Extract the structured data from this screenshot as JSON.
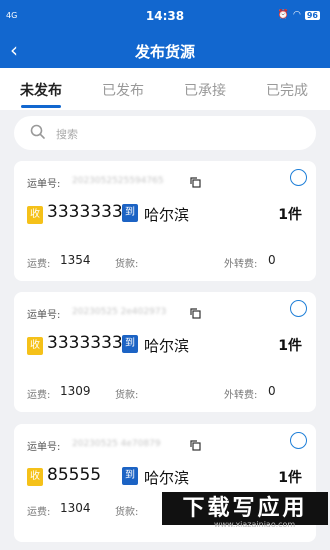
{
  "status_bar": {
    "signal": "4G",
    "time": "14:38",
    "battery": "96"
  },
  "nav": {
    "title": "发布货源"
  },
  "tabs": [
    "未发布",
    "已发布",
    "已承接",
    "已完成"
  ],
  "search": {
    "placeholder": "搜索"
  },
  "labels": {
    "waybill": "运单号:",
    "freight": "运费:",
    "payment": "货款:",
    "transfer": "外转费:"
  },
  "badges": {
    "receiver": "收",
    "destination": "到"
  },
  "cards": [
    {
      "waybill_no": "2023052525594765",
      "sender": "3333333",
      "destination": "哈尔滨",
      "quantity": "1件",
      "freight": "1354",
      "payment": "",
      "transfer_fee": "0"
    },
    {
      "waybill_no": "20230525 2e402973",
      "sender": "3333333",
      "destination": "哈尔滨",
      "quantity": "1件",
      "freight": "1309",
      "payment": "",
      "transfer_fee": "0"
    },
    {
      "waybill_no": "20230525 4e70879",
      "sender": "85555",
      "destination": "哈尔滨",
      "quantity": "1件",
      "freight": "1304",
      "payment": "",
      "transfer_fee": ""
    }
  ],
  "watermark": {
    "logo": "下载写应用",
    "url": "www.xiazainiao.com"
  },
  "colors": {
    "primary": "#1267cf",
    "badge_receiver": "#f5c119",
    "badge_destination": "#1c63c4"
  }
}
